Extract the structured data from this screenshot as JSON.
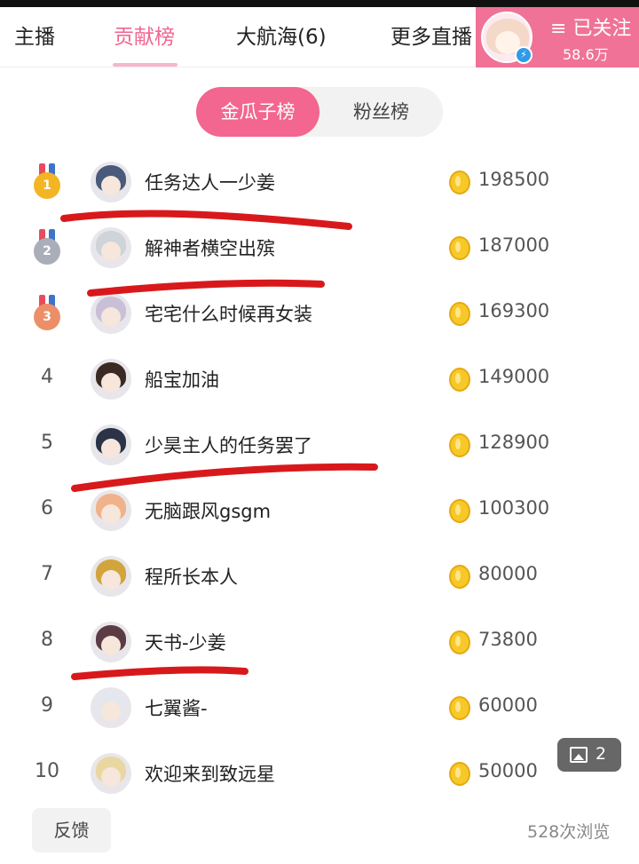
{
  "tabs": [
    {
      "label": "主播",
      "active": false
    },
    {
      "label": "贡献榜",
      "active": true
    },
    {
      "label": "大航海(6)",
      "active": false
    },
    {
      "label": "更多直播",
      "active": false
    }
  ],
  "follow": {
    "label": "≡ 已关注",
    "count": "58.6万",
    "badge_icon": "lightning-icon"
  },
  "segment": {
    "active_label": "金瓜子榜",
    "inactive_label": "粉丝榜"
  },
  "ranking": [
    {
      "rank": "1",
      "name": "任务达人一少姜",
      "score": "198500",
      "medal": "gold"
    },
    {
      "rank": "2",
      "name": "解神者横空出殡",
      "score": "187000",
      "medal": "silver"
    },
    {
      "rank": "3",
      "name": "宅宅什么时候再女装",
      "score": "169300",
      "medal": "bronze"
    },
    {
      "rank": "4",
      "name": "船宝加油",
      "score": "149000"
    },
    {
      "rank": "5",
      "name": "少昊主人的任务罢了",
      "score": "128900"
    },
    {
      "rank": "6",
      "name": "无脑跟风gsgm",
      "score": "100300"
    },
    {
      "rank": "7",
      "name": "程所长本人",
      "score": "80000"
    },
    {
      "rank": "8",
      "name": "天书-少姜",
      "score": "73800"
    },
    {
      "rank": "9",
      "name": "七翼酱-",
      "score": "60000"
    },
    {
      "rank": "10",
      "name": "欢迎来到致远星",
      "score": "50000"
    }
  ],
  "image_badge": {
    "count": "2",
    "icon": "image-icon"
  },
  "footer": {
    "feedback_label": "反馈",
    "views": "528次浏览"
  },
  "colors": {
    "accent": "#f2668f",
    "annotation_red": "#d8191c",
    "coin": "#f6c928"
  }
}
